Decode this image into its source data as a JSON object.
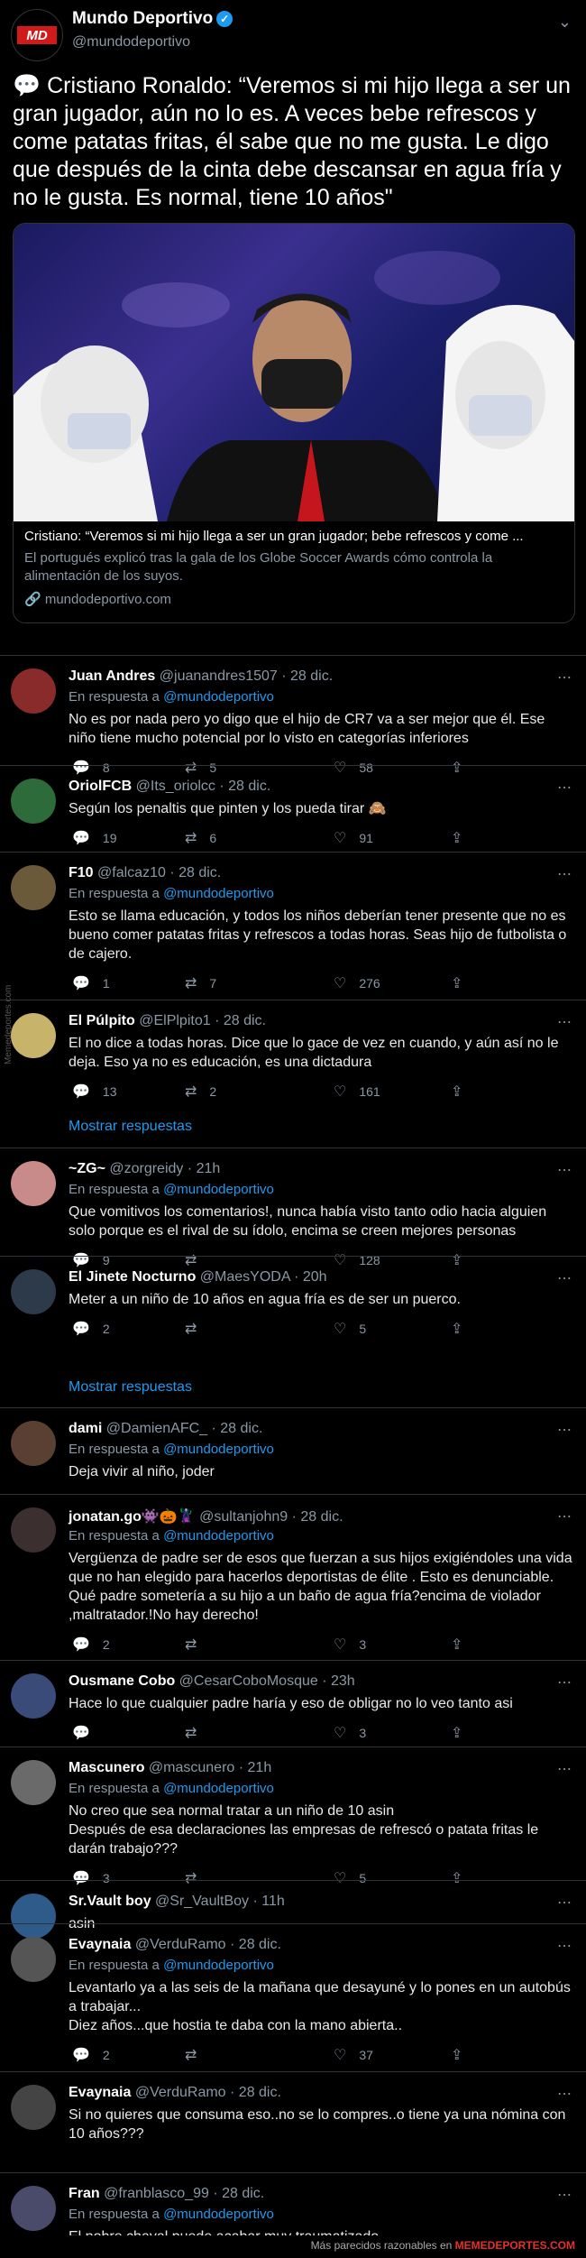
{
  "account": {
    "name": "Mundo Deportivo",
    "handle": "@mundodeportivo",
    "logo_text": "MD"
  },
  "tweet": {
    "text": "💬 Cristiano Ronaldo: “Veremos si mi hijo llega a ser un gran jugador, aún no lo es. A veces bebe refrescos y come patatas fritas, él sabe que no me gusta. Le digo que después de la cinta debe descansar en agua fría y no le gusta. Es normal, tiene 10 años\"",
    "card_title": "Cristiano: “Veremos si mi hijo llega a ser un gran jugador; bebe refrescos y come ...",
    "card_desc": "El portugués explicó tras la gala de los Globe Soccer Awards cómo controla la alimentación de los suyos.",
    "card_link": "🔗 mundodeportivo.com"
  },
  "replies": [
    {
      "name": "Juan Andres",
      "meta": "@juanandres1507 · 28 dic.",
      "inreply": true,
      "text": "No es por nada pero yo digo que el hijo de CR7 va a ser mejor que él. Ese niño tiene mucho potencial por lo visto en categorías inferiores",
      "replies": "8",
      "rts": "5",
      "likes": "58"
    },
    {
      "name": "OriolFCB",
      "meta": "@Its_oriolcc · 28 dic.",
      "inreply": false,
      "text": "Según los penaltis que pinten y los pueda tirar 🙈",
      "replies": "19",
      "rts": "6",
      "likes": "91"
    },
    {
      "name": "F10",
      "meta": "@falcaz10 · 28 dic.",
      "inreply": true,
      "text": "Esto se llama educación, y todos los niños deberían tener presente que no es bueno comer patatas fritas y refrescos a todas horas. Seas hijo de futbolista o de cajero.",
      "replies": "1",
      "rts": "7",
      "likes": "276"
    },
    {
      "name": "El Púlpito",
      "meta": "@ElPlpito1 · 28 dic.",
      "inreply": false,
      "text": "El no dice a todas horas. Dice que lo gace de vez en cuando, y aún así no le deja. Eso ya no es educación, es una dictadura",
      "replies": "13",
      "rts": "2",
      "likes": "161"
    },
    {
      "name": "~ZG~",
      "meta": "@zorgreidy · 21h",
      "inreply": true,
      "text": "Que vomitivos los comentarios!, nunca había visto tanto odio hacia alguien solo porque es el rival de su ídolo, encima se creen mejores personas",
      "replies": "9",
      "rts": "",
      "likes": "128"
    },
    {
      "name": "El Jinete Nocturno",
      "meta": "@MaesYODA · 20h",
      "inreply": false,
      "text": "Meter a un niño de 10 años en agua fría es de ser un puerco.",
      "replies": "2",
      "rts": "",
      "likes": "5"
    },
    {
      "name": "dami",
      "meta": "@DamienAFC_ · 28 dic.",
      "inreply": true,
      "text": "Deja vivir al niño, joder",
      "replies": "",
      "rts": "",
      "likes": ""
    },
    {
      "name": "jonatan.go👾🎃🦹",
      "meta": "@sultanjohn9 · 28 dic.",
      "inreply": true,
      "text": "Vergüenza de padre ser de esos que fuerzan a sus hijos exigiéndoles una vida que no han elegido para hacerlos deportistas de élite . Esto es denunciable. Qué padre sometería a su hijo a un baño de agua fría?encima de violador ,maltratador.!No hay derecho!",
      "replies": "2",
      "rts": "",
      "likes": "3"
    },
    {
      "name": "Ousmane Cobo",
      "meta": "@CesarCoboMosque · 23h",
      "inreply": false,
      "text": "Hace lo que cualquier padre haría y eso de obligar no lo veo tanto asi",
      "replies": "",
      "rts": "",
      "likes": "3"
    },
    {
      "name": "Mascunero",
      "meta": "@mascunero · 21h",
      "inreply": true,
      "text": "No creo que sea normal tratar a un niño de 10 asin\nDespués de esa declaraciones las empresas de refrescó o patata fritas le darán trabajo???",
      "replies": "3",
      "rts": "",
      "likes": "5"
    },
    {
      "name": "Sr.Vault boy",
      "meta": "@Sr_VaultBoy · 11h",
      "inreply": false,
      "text": "asin",
      "replies": "",
      "rts": "",
      "likes": ""
    },
    {
      "name": "Evaynaia",
      "meta": "@VerduRamo · 28 dic.",
      "inreply": true,
      "text": "Levantarlo ya a las seis de la mañana que desayuné y lo pones en un autobús a trabajar...\nDiez años...que hostia te daba con la mano abierta..",
      "replies": "2",
      "rts": "",
      "likes": "37"
    },
    {
      "name": "Evaynaia",
      "meta": "@VerduRamo · 28 dic.",
      "inreply": false,
      "text": "Si no quieres que consuma eso..no se lo compres..o tiene ya una nómina con 10 años???",
      "replies": "",
      "rts": "",
      "likes": ""
    },
    {
      "name": "Fran",
      "meta": "@franblasco_99 · 28 dic.",
      "inreply": true,
      "text": "El pobre chaval puede acabar muy traumatizado",
      "replies": "",
      "rts": "",
      "likes": ""
    }
  ],
  "inreply_prefix": "En respuesta a ",
  "inreply_target": "@mundodeportivo",
  "show_more": "Mostrar respuestas",
  "footer": {
    "text": "Más parecidos razonables en ",
    "brand": "MEMEDEPORTES.COM"
  },
  "watermark": "Memedeportes.com",
  "colors": {
    "accent": "#1d9bf0",
    "background": "#000000",
    "brand_red": "#e5302a"
  }
}
